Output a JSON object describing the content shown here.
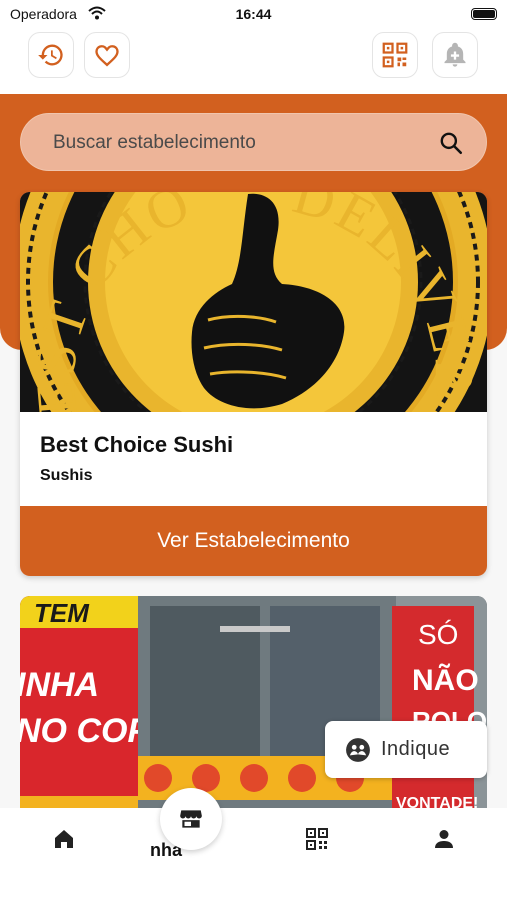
{
  "status_bar": {
    "carrier": "Operadora",
    "time": "16:44"
  },
  "toolbar": {
    "left_icons": [
      "history-icon",
      "heart-icon"
    ],
    "right_icons": [
      "qr-scan-icon",
      "notification-add-icon"
    ]
  },
  "search": {
    "placeholder": "Buscar estabelecimento",
    "value": ""
  },
  "store_card": {
    "image_ring_text": "BEST CHOICE DELIVERY",
    "image_visible_left": "BEST CHO",
    "image_visible_right": "DELIVER",
    "title": "Best Choice Sushi",
    "category": "Sushis",
    "button_label": "Ver Estabelecimento"
  },
  "second_card": {
    "banner_top": "TEM",
    "banner_line1": "INHA",
    "banner_line2": "NO COPO",
    "sign_line1": "SÓ",
    "sign_line2": "NÃO",
    "sign_line3": "ROLO",
    "sign_bottom": "VONTADE!"
  },
  "indique": {
    "label": "Indique"
  },
  "bottom_nav": {
    "items": [
      "home-icon",
      "store-icon",
      "qr-code-icon",
      "profile-icon"
    ],
    "partial_label": "nha"
  },
  "colors": {
    "brand": "#d2601f",
    "search_bg": "#edb498"
  }
}
